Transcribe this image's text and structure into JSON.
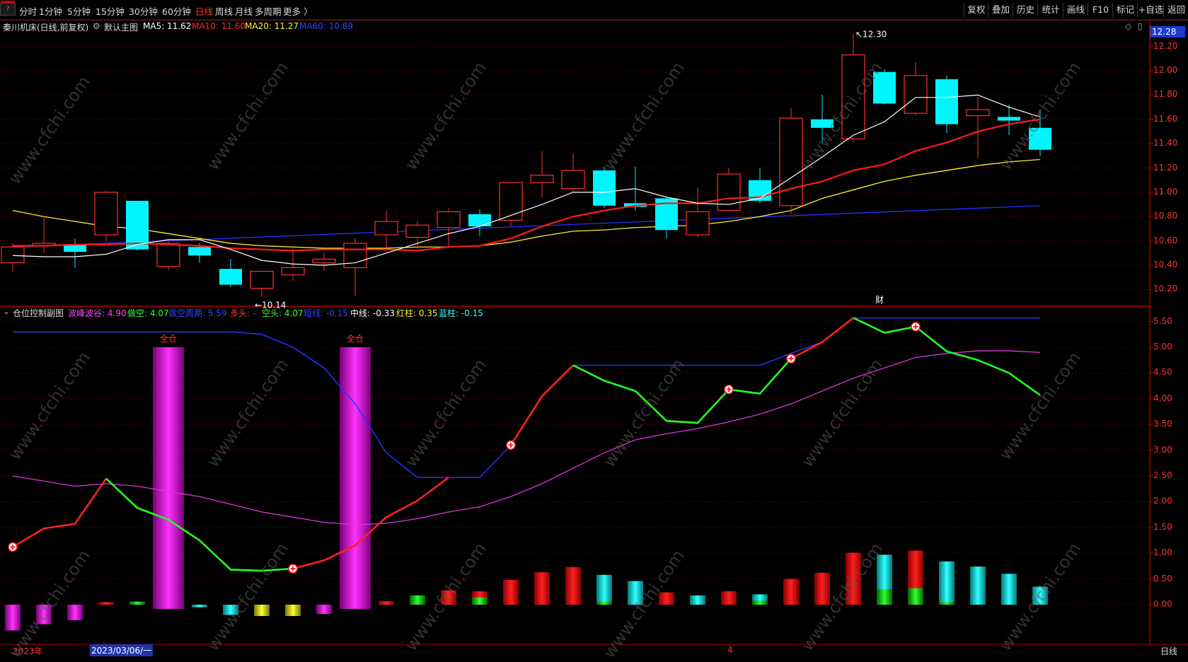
{
  "toolbar": {
    "win_icon": "?",
    "periods": [
      "分时",
      "1分钟",
      "5分钟",
      "15分钟",
      "30分钟",
      "60分钟",
      "日线",
      "周线",
      "月线",
      "多周期",
      "更多 〉"
    ],
    "active_period": "日线",
    "right_buttons": [
      "复权",
      "叠加",
      "历史",
      "统计",
      "画线",
      "F10",
      "标记",
      "+自选",
      "返回"
    ]
  },
  "main_chart": {
    "stock_name": "秦川机床(日线,前复权)",
    "view_label": "默认主图",
    "ma": [
      {
        "label": "MA5: 11.62",
        "color": "#ffffff"
      },
      {
        "label": "MA10: 11.60",
        "color": "#ff2a2a"
      },
      {
        "label": "MA20: 11.27",
        "color": "#ffee33"
      },
      {
        "label": "MA60: 10.89",
        "color": "#3344ff"
      }
    ],
    "current_price": "12.28",
    "high_annotation": "12.30",
    "low_annotation": "10.14",
    "marker_cai": "财",
    "y_axis_labels": [
      "12.20",
      "12.00",
      "11.80",
      "11.60",
      "11.40",
      "11.20",
      "11.00",
      "10.80",
      "10.60",
      "10.40",
      "10.20"
    ]
  },
  "sub_chart": {
    "title": "仓位控制副图",
    "params": [
      {
        "label": "波峰波谷: 4.90",
        "color": "#ff44ff"
      },
      {
        "label": "做空: 4.07",
        "color": "#33ff33"
      },
      {
        "label": "做空周期: 5.59",
        "color": "#3344ff"
      },
      {
        "label": "多头: -",
        "color": "#ff3333"
      },
      {
        "label": "空头: 4.07",
        "color": "#33ff33"
      },
      {
        "label": "短线: -0.15",
        "color": "#3344ff"
      },
      {
        "label": "中线: -0.33",
        "color": "#ffffff"
      },
      {
        "label": "红柱: 0.35",
        "color": "#ffee33"
      },
      {
        "label": "蓝柱: -0.15",
        "color": "#33ffff"
      }
    ],
    "full_position_label": "全仓",
    "y_axis_labels": [
      "5.50",
      "5.00",
      "4.50",
      "4.00",
      "3.50",
      "3.00",
      "2.50",
      "2.00",
      "1.50",
      "1.00",
      "0.50",
      "0.00"
    ]
  },
  "bottom": {
    "year_label": "2023年",
    "date_label": "2023/03/06/一",
    "month_marker": "4",
    "period_label": "日线"
  },
  "watermark": "www.cfchi.com",
  "chart_data": {
    "type": "candlestick",
    "candles": [
      {
        "o": 10.42,
        "c": 10.55,
        "h": 10.58,
        "l": 10.35
      },
      {
        "o": 10.56,
        "c": 10.58,
        "h": 10.81,
        "l": 10.5
      },
      {
        "o": 10.57,
        "c": 10.51,
        "h": 10.62,
        "l": 10.38
      },
      {
        "o": 10.65,
        "c": 11.0,
        "h": 11.01,
        "l": 10.6
      },
      {
        "o": 10.93,
        "c": 10.53,
        "h": 10.93,
        "l": 10.52
      },
      {
        "o": 10.39,
        "c": 10.58,
        "h": 10.6,
        "l": 10.36
      },
      {
        "o": 10.55,
        "c": 10.48,
        "h": 10.58,
        "l": 10.42
      },
      {
        "o": 10.37,
        "c": 10.24,
        "h": 10.45,
        "l": 10.22
      },
      {
        "o": 10.21,
        "c": 10.35,
        "h": 10.35,
        "l": 10.14
      },
      {
        "o": 10.32,
        "c": 10.38,
        "h": 10.55,
        "l": 10.27
      },
      {
        "o": 10.42,
        "c": 10.45,
        "h": 10.5,
        "l": 10.36
      },
      {
        "o": 10.38,
        "c": 10.58,
        "h": 10.62,
        "l": 10.15
      },
      {
        "o": 10.65,
        "c": 10.76,
        "h": 10.85,
        "l": 10.52
      },
      {
        "o": 10.63,
        "c": 10.73,
        "h": 10.76,
        "l": 10.54
      },
      {
        "o": 10.71,
        "c": 10.84,
        "h": 10.87,
        "l": 10.55
      },
      {
        "o": 10.82,
        "c": 10.72,
        "h": 10.86,
        "l": 10.64
      },
      {
        "o": 10.77,
        "c": 11.08,
        "h": 11.08,
        "l": 10.72
      },
      {
        "o": 11.08,
        "c": 11.14,
        "h": 11.34,
        "l": 10.96
      },
      {
        "o": 11.03,
        "c": 11.18,
        "h": 11.32,
        "l": 11.0
      },
      {
        "o": 11.18,
        "c": 10.89,
        "h": 11.21,
        "l": 10.87
      },
      {
        "o": 10.91,
        "c": 10.88,
        "h": 11.21,
        "l": 10.85
      },
      {
        "o": 10.95,
        "c": 10.69,
        "h": 10.96,
        "l": 10.62
      },
      {
        "o": 10.65,
        "c": 10.84,
        "h": 11.04,
        "l": 10.63
      },
      {
        "o": 10.85,
        "c": 11.15,
        "h": 11.2,
        "l": 10.84
      },
      {
        "o": 11.1,
        "c": 10.93,
        "h": 11.2,
        "l": 10.91
      },
      {
        "o": 10.89,
        "c": 11.61,
        "h": 11.69,
        "l": 10.82
      },
      {
        "o": 11.6,
        "c": 11.53,
        "h": 11.8,
        "l": 11.41
      },
      {
        "o": 11.44,
        "c": 12.13,
        "h": 12.3,
        "l": 11.41
      },
      {
        "o": 11.99,
        "c": 11.73,
        "h": 12.01,
        "l": 11.72
      },
      {
        "o": 11.65,
        "c": 11.96,
        "h": 12.07,
        "l": 11.63
      },
      {
        "o": 11.93,
        "c": 11.56,
        "h": 11.96,
        "l": 11.49
      },
      {
        "o": 11.63,
        "c": 11.68,
        "h": 11.78,
        "l": 11.28
      },
      {
        "o": 11.62,
        "c": 11.59,
        "h": 11.72,
        "l": 11.47
      },
      {
        "o": 11.53,
        "c": 11.35,
        "h": 11.68,
        "l": 11.3
      }
    ],
    "ma5": [
      10.48,
      10.47,
      10.47,
      10.49,
      10.57,
      10.61,
      10.61,
      10.53,
      10.44,
      10.41,
      10.4,
      10.42,
      10.5,
      10.58,
      10.66,
      10.72,
      10.81,
      10.9,
      11.0,
      11.0,
      11.03,
      10.96,
      10.91,
      10.9,
      10.95,
      11.12,
      11.29,
      11.47,
      11.58,
      11.78,
      11.78,
      11.8,
      11.7,
      11.62
    ],
    "ma10": [
      10.56,
      10.56,
      10.57,
      10.57,
      10.58,
      10.57,
      10.56,
      10.54,
      10.53,
      10.52,
      10.53,
      10.53,
      10.53,
      10.52,
      10.55,
      10.56,
      10.62,
      10.72,
      10.8,
      10.85,
      10.89,
      10.91,
      10.91,
      10.95,
      10.96,
      11.03,
      11.09,
      11.18,
      11.23,
      11.34,
      11.41,
      11.5,
      11.56,
      11.6
    ],
    "ma20": [
      10.85,
      10.8,
      10.76,
      10.72,
      10.7,
      10.66,
      10.62,
      10.58,
      10.56,
      10.55,
      10.54,
      10.54,
      10.54,
      10.55,
      10.55,
      10.56,
      10.59,
      10.64,
      10.68,
      10.69,
      10.71,
      10.72,
      10.73,
      10.76,
      10.8,
      10.85,
      10.95,
      11.02,
      11.09,
      11.14,
      11.18,
      11.22,
      11.25,
      11.27
    ],
    "ma60_start": 10.55,
    "ma60_end": 10.89,
    "y_range": [
      10.08,
      12.32
    ],
    "sub_bars": [
      -0.5,
      -0.38,
      -0.3,
      0.05,
      0.06,
      5.0,
      -0.05,
      -0.2,
      -0.22,
      -0.22,
      -0.18,
      5.0,
      0.07,
      0.18,
      0.28,
      0.26,
      0.48,
      0.63,
      0.73,
      0.58,
      0.46,
      0.24,
      0.18,
      0.26,
      0.2,
      0.5,
      0.62,
      1.01,
      0.97,
      1.05,
      0.84,
      0.74,
      0.6,
      0.35
    ],
    "sub_y_range": [
      -0.55,
      5.7
    ]
  }
}
